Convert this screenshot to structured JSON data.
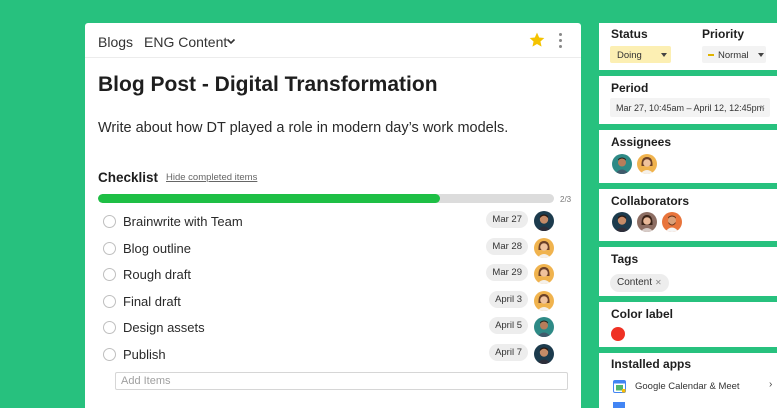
{
  "header": {
    "breadcrumb_root": "Blogs",
    "breadcrumb_section": "ENG Content",
    "star_color": "#f4c300"
  },
  "task": {
    "title": "Blog Post - Digital Transformation",
    "description": "Write about how DT played a role in modern day’s work models."
  },
  "checklist": {
    "title": "Checklist",
    "hide_completed": "Hide completed items",
    "progress_text": "2/3",
    "progress_fraction": 0.75,
    "items": [
      {
        "label": "Brainwrite with Team",
        "date": "Mar 27",
        "avatar": "man-dark"
      },
      {
        "label": "Blog outline",
        "date": "Mar 28",
        "avatar": "woman-blonde"
      },
      {
        "label": "Rough draft",
        "date": "Mar 29",
        "avatar": "woman-blonde"
      },
      {
        "label": "Final draft",
        "date": "April 3",
        "avatar": "woman-blonde"
      },
      {
        "label": "Design assets",
        "date": "April 5",
        "avatar": "man-teal"
      },
      {
        "label": "Publish",
        "date": "April 7",
        "avatar": "man-dark"
      }
    ],
    "add_placeholder": "Add Items"
  },
  "sidebar": {
    "status": {
      "title": "Status",
      "value": "Doing",
      "color": "#fcefb3"
    },
    "priority": {
      "title": "Priority",
      "value": "Normal"
    },
    "period": {
      "title": "Period",
      "value": "Mar 27, 10:45am – April 12, 12:45pm"
    },
    "assignees": {
      "title": "Assignees",
      "avatars": [
        "man-teal",
        "woman-blonde"
      ]
    },
    "collaborators": {
      "title": "Collaborators",
      "avatars": [
        "man-dark",
        "woman-brown",
        "man-beard"
      ]
    },
    "tags": {
      "title": "Tags",
      "items": [
        "Content"
      ]
    },
    "color_label": {
      "title": "Color label",
      "color": "#ef3124"
    },
    "installed_apps": {
      "title": "Installed apps",
      "items": [
        {
          "name": "Google Calendar & Meet",
          "icon": "calendar-icon"
        }
      ]
    }
  }
}
